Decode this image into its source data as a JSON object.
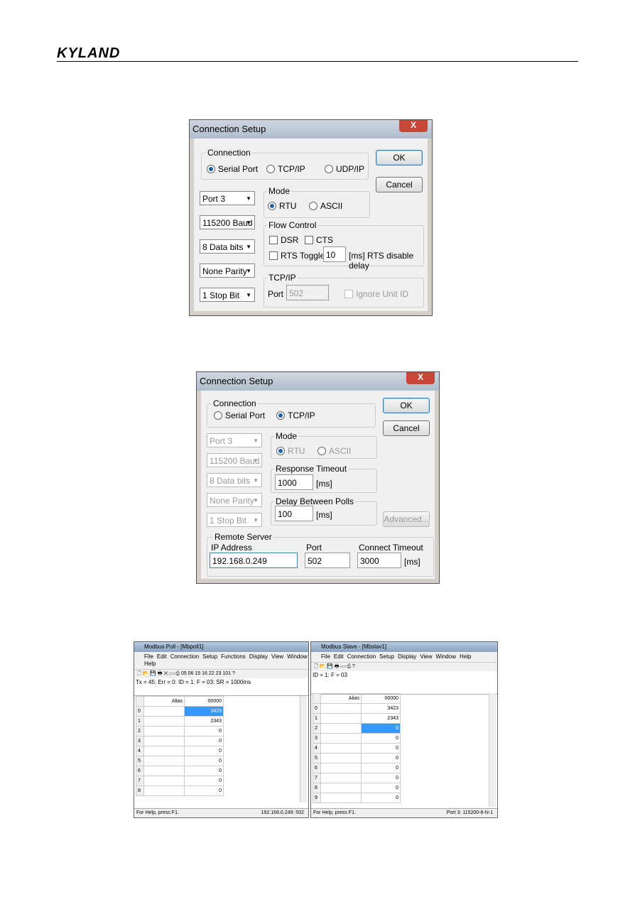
{
  "header": {
    "logo": "KYLAND"
  },
  "dialog1": {
    "title": "Connection Setup",
    "close": "X",
    "connection_label": "Connection",
    "conn_options": [
      "Serial Port",
      "TCP/IP",
      "UDP/IP"
    ],
    "selected": "Serial Port",
    "ok": "OK",
    "cancel": "Cancel",
    "port": "Port 3",
    "baud": "115200 Baud",
    "data_bits": "8 Data bits",
    "parity": "None Parity",
    "stop": "1 Stop Bit",
    "mode_label": "Mode",
    "mode_options": [
      "RTU",
      "ASCII"
    ],
    "mode_selected": "RTU",
    "flow_label": "Flow Control",
    "dsr": "DSR",
    "cts": "CTS",
    "rts": "RTS Toggle",
    "rts_value": "10",
    "rts_suffix": "[ms] RTS disable delay",
    "tcp_label": "TCP/IP",
    "tcp_port_label": "Port",
    "tcp_port": "502",
    "ignore": "Ignore Unit ID"
  },
  "dialog2": {
    "title": "Connection Setup",
    "close": "X",
    "connection_label": "Connection",
    "conn_options": [
      "Serial Port",
      "TCP/IP"
    ],
    "selected": "TCP/IP",
    "ok": "OK",
    "cancel": "Cancel",
    "port": "Port 3",
    "baud": "115200 Baud",
    "data_bits": "8 Data bits",
    "parity": "None Parity",
    "stop": "1 Stop Bit",
    "mode_label": "Mode",
    "mode_options": [
      "RTU",
      "ASCII"
    ],
    "resp_label": "Response Timeout",
    "resp_value": "1000",
    "ms": "[ms]",
    "delay_label": "Delay Between Polls",
    "delay_value": "100",
    "advanced": "Advanced...",
    "remote_label": "Remote Server",
    "ip_label": "IP Address",
    "ip_value": "192.168.0.249",
    "port_label": "Port",
    "port_value": "502",
    "ct_label": "Connect Timeout",
    "ct_value": "3000"
  },
  "poll": {
    "title": "Modbus Poll - [Mbpoll1]",
    "menu": [
      "File",
      "Edit",
      "Connection",
      "Setup",
      "Functions",
      "Display",
      "View",
      "Window",
      "Help"
    ],
    "toolbar": "05 06 15 16 22 23 101",
    "status": "Tx = 45: Err = 0: ID = 1: F = 03: SR = 1000ms",
    "col_alias": "Alias",
    "col_addr": "00000",
    "rows": [
      "3423",
      "2343",
      "0",
      "0",
      "0",
      "0",
      "0",
      "0",
      "0"
    ],
    "highlight": 0,
    "footer_left": "For Help, press F1.",
    "footer_right": "192.168.0.249: 502"
  },
  "slave": {
    "title": "Modbus Slave - [Mbslav1]",
    "menu": [
      "File",
      "Edit",
      "Connection",
      "Setup",
      "Display",
      "View",
      "Window",
      "Help"
    ],
    "status": "ID = 1: F = 03",
    "col_alias": "Alias",
    "col_addr": "00000",
    "rows": [
      "3423",
      "2343",
      "0",
      "0",
      "0",
      "0",
      "0",
      "0",
      "0",
      "0"
    ],
    "highlight": 2,
    "footer_left": "For Help, press F1.",
    "footer_right": "Port 3: 115200-8-N-1"
  }
}
